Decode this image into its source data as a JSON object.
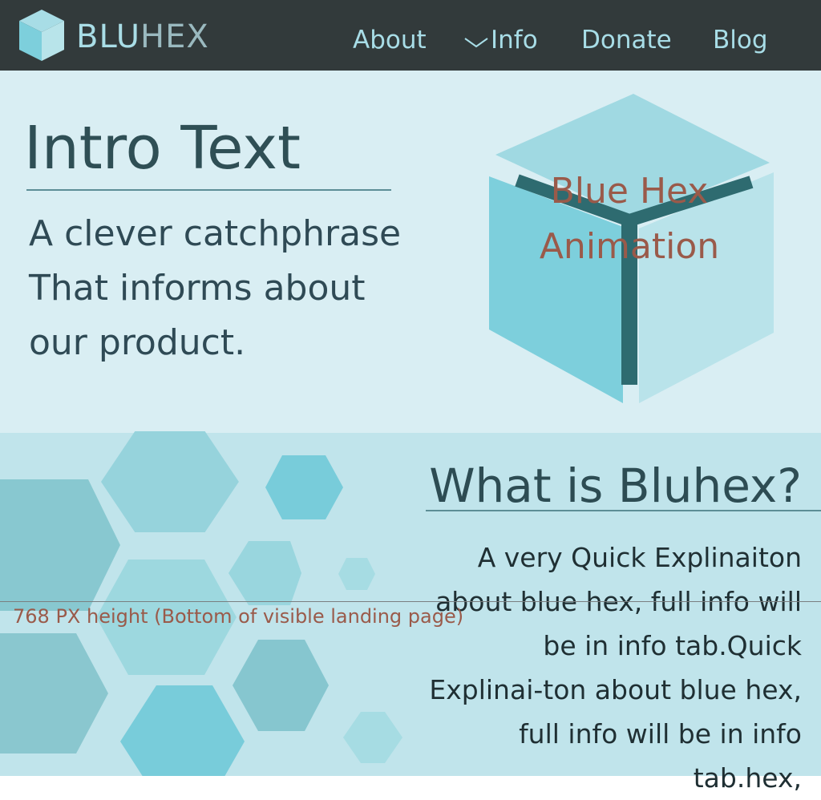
{
  "header": {
    "brand_part1": "BLU",
    "brand_part2": "HEX",
    "nav": {
      "about": "About",
      "info": "Info",
      "donate": "Donate",
      "blog": "Blog"
    }
  },
  "hero": {
    "title": "Intro Text",
    "tagline": "A clever catchphrase That informs about our product.",
    "animation_label": "Blue Hex Animation"
  },
  "about": {
    "title": "What is Bluhex?",
    "paragraph": "A very Quick Explinaiton about blue hex, full info will be in info tab.Quick Explinai-ton about blue hex, full info will be in info tab.hex,"
  },
  "annotation": {
    "fold_marker": "768 PX height (Bottom of visible landing page)"
  },
  "colors": {
    "header_bg": "#323a3b",
    "nav_text": "#a8dde7",
    "hero_bg": "#d9eef3",
    "about_bg": "#c0e4eb",
    "accent_rust": "#9a5a4a",
    "cube_dark": "#2e6b70"
  },
  "icons": {
    "logo": "cube-logo-icon",
    "info_dropdown": "chevron-down-icon"
  }
}
